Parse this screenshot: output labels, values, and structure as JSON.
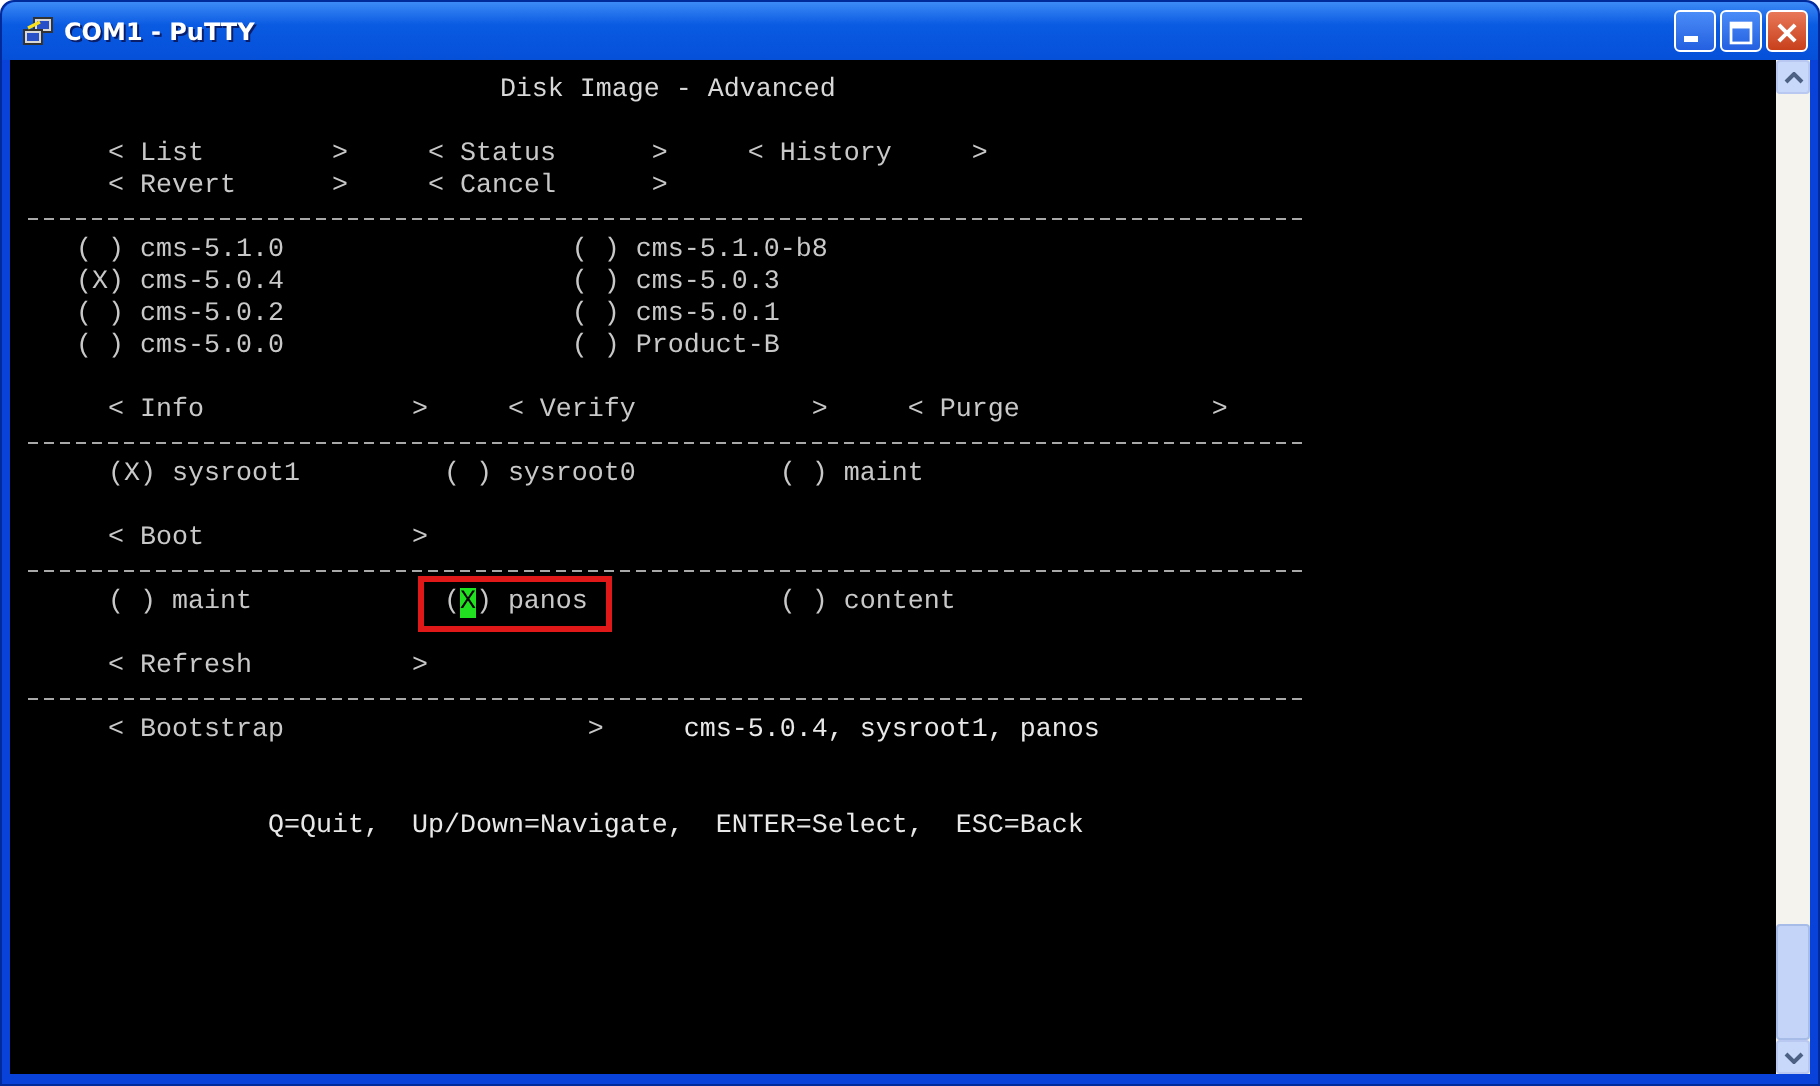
{
  "window": {
    "title": "COM1 - PuTTY"
  },
  "terminal": {
    "rows": [
      {
        "kind": "heading",
        "text": "Disk Image - Advanced"
      },
      {
        "kind": "menu",
        "items": [
          {
            "kind": "button",
            "text": "< List        >"
          },
          {
            "kind": "button",
            "text": "< Status      >"
          },
          {
            "kind": "button",
            "text": "< History     >"
          }
        ]
      },
      {
        "kind": "menu",
        "items": [
          {
            "kind": "button",
            "text": "< Revert      >"
          },
          {
            "kind": "button",
            "text": "< Cancel      >"
          }
        ]
      },
      {
        "kind": "rule"
      },
      {
        "kind": "image-grid",
        "items": [
          {
            "marker": "( )",
            "label": "cms-5.1.0"
          },
          {
            "marker": "( )",
            "label": "cms-5.1.0-b8"
          },
          {
            "marker": "(X)",
            "label": "cms-5.0.4"
          },
          {
            "marker": "( )",
            "label": "cms-5.0.3"
          },
          {
            "marker": "( )",
            "label": "cms-5.0.2"
          },
          {
            "marker": "( )",
            "label": "cms-5.0.1"
          },
          {
            "marker": "( )",
            "label": "cms-5.0.0"
          },
          {
            "marker": "( )",
            "label": "Product-B"
          }
        ]
      },
      {
        "kind": "menu",
        "items": [
          {
            "kind": "button",
            "text": "< Info             >"
          },
          {
            "kind": "button",
            "text": "< Verify           >"
          },
          {
            "kind": "button",
            "text": "< Purge            >"
          }
        ]
      },
      {
        "kind": "rule"
      },
      {
        "kind": "choice-row",
        "items": [
          {
            "marker": "(X)",
            "label": "sysroot1",
            "cursor": false,
            "highlighted": false
          },
          {
            "marker": "( )",
            "label": "sysroot0",
            "cursor": false,
            "highlighted": false
          },
          {
            "marker": "( )",
            "label": "maint",
            "cursor": false,
            "highlighted": false
          }
        ]
      },
      {
        "kind": "menu",
        "items": [
          {
            "kind": "button",
            "text": "< Boot             >"
          }
        ]
      },
      {
        "kind": "rule"
      },
      {
        "kind": "choice-row",
        "items": [
          {
            "marker": "( )",
            "label": "maint",
            "cursor": false,
            "highlighted": false
          },
          {
            "marker": "(X)",
            "label": "panos",
            "cursor": true,
            "highlighted": true
          },
          {
            "marker": "( )",
            "label": "content",
            "cursor": false,
            "highlighted": false
          }
        ]
      },
      {
        "kind": "menu",
        "items": [
          {
            "kind": "button",
            "text": "< Refresh          >"
          }
        ]
      },
      {
        "kind": "rule"
      },
      {
        "kind": "menu",
        "items": [
          {
            "kind": "button",
            "text": "< Bootstrap                   >"
          },
          {
            "kind": "text",
            "text": "cms-5.0.4, sysroot1, panos"
          }
        ]
      },
      {
        "kind": "help",
        "text": "Q=Quit,  Up/Down=Navigate,  ENTER=Select,  ESC=Back"
      }
    ]
  }
}
